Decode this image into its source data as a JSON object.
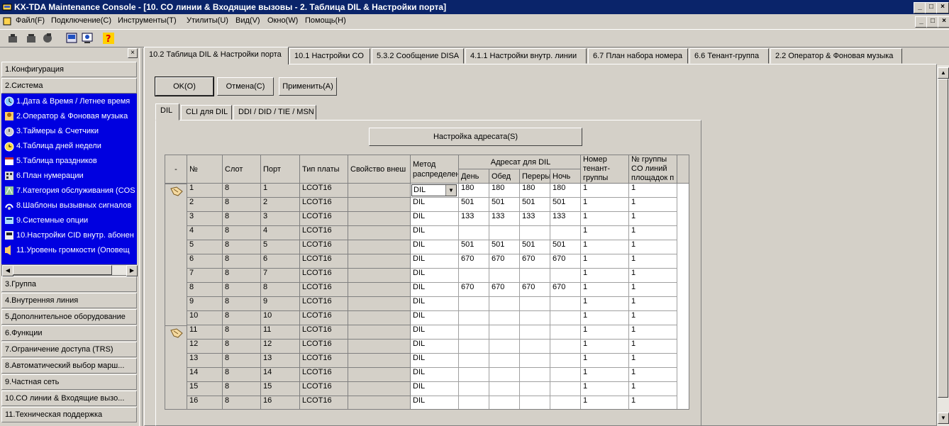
{
  "window": {
    "title": "KX-TDA Maintenance Console - [10. CO линии & Входящие вызовы - 2. Таблица DIL & Настройки порта]",
    "controls": [
      "_",
      "□",
      "×"
    ]
  },
  "menu": {
    "items": [
      "Файл(F)",
      "Подключение(C)",
      "Инструменты(T)",
      "Утилиты(U)",
      "Вид(V)",
      "Окно(W)",
      "Помощь(H)"
    ]
  },
  "sidebar": {
    "categories": [
      "1.Конфигурация",
      "2.Система",
      "3.Группа",
      "4.Внутренняя линия",
      "5.Дополнительное оборудование",
      "6.Функции",
      "7.Ограничение доступа (TRS)",
      "8.Автоматический выбор марш...",
      "9.Частная сеть",
      "10.CO линии & Входящие вызо...",
      "11.Техническая поддержка"
    ],
    "system_items": [
      "1.Дата & Время / Летнее время",
      "2.Оператор & Фоновая музыка",
      "3.Таймеры & Счетчики",
      "4.Таблица дней недели",
      "5.Таблица праздников",
      "6.План нумерации",
      "7.Категория обслуживания (COS",
      "8.Шаблоны вызывных сигналов",
      "9.Системные опции",
      "10.Настройки CID внутр. абонен",
      "11.Уровень громкости (Оповещ"
    ],
    "close_glyph": "×"
  },
  "tabs": [
    "10.2 Таблица DIL & Настройки порта",
    "10.1 Настройки CO",
    "5.3.2 Сообщение DISA",
    "4.1.1 Настройки внутр. линии",
    "6.7 План набора номера",
    "6.6 Тенант-группа",
    "2.2 Оператор & Фоновая музыка"
  ],
  "buttons": {
    "ok": "OK(O)",
    "cancel": "Отмена(C)",
    "apply": "Применить(A)",
    "dest_settings": "Настройка адресата(S)"
  },
  "subtabs": [
    "DIL",
    "CLI для DIL",
    "DDI / DID / TIE / MSN"
  ],
  "table": {
    "headers": {
      "dash": "-",
      "no": "№",
      "slot": "Слот",
      "port": "Порт",
      "card_type": "Тип платы",
      "property": "Свойство внеш",
      "method_l1": "Метод",
      "method_l2": "распределен",
      "dest_group": "Адресат для DIL",
      "day": "День",
      "lunch": "Обед",
      "break": "Переры",
      "night": "Ночь",
      "tenant_l1": "Номер",
      "tenant_l2": "тенант-",
      "tenant_l3": "группы",
      "co_group_l1": "№ группы",
      "co_group_l2": "CO линий",
      "co_group_l3": "площадок п"
    },
    "rows": [
      {
        "no": "1",
        "slot": "8",
        "port": "1",
        "type": "LCOT16",
        "method": "DIL",
        "day": "180",
        "lunch": "180",
        "brk": "180",
        "night": "180",
        "tenant": "1",
        "cogrp": "1"
      },
      {
        "no": "2",
        "slot": "8",
        "port": "2",
        "type": "LCOT16",
        "method": "DIL",
        "day": "501",
        "lunch": "501",
        "brk": "501",
        "night": "501",
        "tenant": "1",
        "cogrp": "1"
      },
      {
        "no": "3",
        "slot": "8",
        "port": "3",
        "type": "LCOT16",
        "method": "DIL",
        "day": "133",
        "lunch": "133",
        "brk": "133",
        "night": "133",
        "tenant": "1",
        "cogrp": "1"
      },
      {
        "no": "4",
        "slot": "8",
        "port": "4",
        "type": "LCOT16",
        "method": "DIL",
        "day": "",
        "lunch": "",
        "brk": "",
        "night": "",
        "tenant": "1",
        "cogrp": "1"
      },
      {
        "no": "5",
        "slot": "8",
        "port": "5",
        "type": "LCOT16",
        "method": "DIL",
        "day": "501",
        "lunch": "501",
        "brk": "501",
        "night": "501",
        "tenant": "1",
        "cogrp": "1"
      },
      {
        "no": "6",
        "slot": "8",
        "port": "6",
        "type": "LCOT16",
        "method": "DIL",
        "day": "670",
        "lunch": "670",
        "brk": "670",
        "night": "670",
        "tenant": "1",
        "cogrp": "1"
      },
      {
        "no": "7",
        "slot": "8",
        "port": "7",
        "type": "LCOT16",
        "method": "DIL",
        "day": "",
        "lunch": "",
        "brk": "",
        "night": "",
        "tenant": "1",
        "cogrp": "1"
      },
      {
        "no": "8",
        "slot": "8",
        "port": "8",
        "type": "LCOT16",
        "method": "DIL",
        "day": "670",
        "lunch": "670",
        "brk": "670",
        "night": "670",
        "tenant": "1",
        "cogrp": "1"
      },
      {
        "no": "9",
        "slot": "8",
        "port": "9",
        "type": "LCOT16",
        "method": "DIL",
        "day": "",
        "lunch": "",
        "brk": "",
        "night": "",
        "tenant": "1",
        "cogrp": "1"
      },
      {
        "no": "10",
        "slot": "8",
        "port": "10",
        "type": "LCOT16",
        "method": "DIL",
        "day": "",
        "lunch": "",
        "brk": "",
        "night": "",
        "tenant": "1",
        "cogrp": "1"
      },
      {
        "no": "11",
        "slot": "8",
        "port": "11",
        "type": "LCOT16",
        "method": "DIL",
        "day": "",
        "lunch": "",
        "brk": "",
        "night": "",
        "tenant": "1",
        "cogrp": "1"
      },
      {
        "no": "12",
        "slot": "8",
        "port": "12",
        "type": "LCOT16",
        "method": "DIL",
        "day": "",
        "lunch": "",
        "brk": "",
        "night": "",
        "tenant": "1",
        "cogrp": "1"
      },
      {
        "no": "13",
        "slot": "8",
        "port": "13",
        "type": "LCOT16",
        "method": "DIL",
        "day": "",
        "lunch": "",
        "brk": "",
        "night": "",
        "tenant": "1",
        "cogrp": "1"
      },
      {
        "no": "14",
        "slot": "8",
        "port": "14",
        "type": "LCOT16",
        "method": "DIL",
        "day": "",
        "lunch": "",
        "brk": "",
        "night": "",
        "tenant": "1",
        "cogrp": "1"
      },
      {
        "no": "15",
        "slot": "8",
        "port": "15",
        "type": "LCOT16",
        "method": "DIL",
        "day": "",
        "lunch": "",
        "brk": "",
        "night": "",
        "tenant": "1",
        "cogrp": "1"
      },
      {
        "no": "16",
        "slot": "8",
        "port": "16",
        "type": "LCOT16",
        "method": "DIL",
        "day": "",
        "lunch": "",
        "brk": "",
        "night": "",
        "tenant": "1",
        "cogrp": "1"
      }
    ],
    "group_marker_rows": [
      1,
      11
    ],
    "combo_arrow": "▼"
  },
  "scroll_glyphs": {
    "left": "◀",
    "right": "▶",
    "up": "▲",
    "down": "▼"
  },
  "colors": {
    "titlebar": "#0a246a",
    "selection": "#0000e0",
    "face": "#d4d0c8"
  }
}
